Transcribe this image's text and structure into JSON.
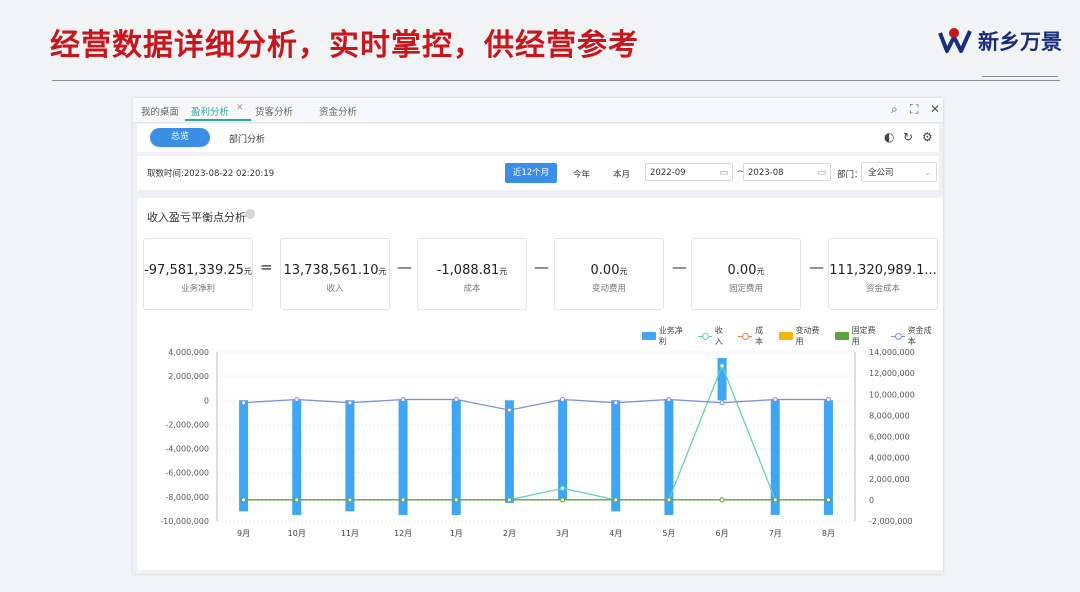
{
  "slide": {
    "title": "经营数据详细分析，实时掌控，供经营参考",
    "brand": "新乡万景"
  },
  "tabs": [
    {
      "label": "我的桌面"
    },
    {
      "label": "盈利分析",
      "active": true
    },
    {
      "label": "货客分析"
    },
    {
      "label": "资金分析"
    }
  ],
  "subnav": {
    "overview": "总览",
    "department": "部门分析"
  },
  "filter": {
    "fetch_time": "取数时间:2023-08-22 02:20:19",
    "btn_recent": "近12个月",
    "btn_year": "今年",
    "btn_month": "本月",
    "date_from": "2022-09",
    "date_to": "2023-08",
    "tilde": "~",
    "dept_label": "部门：",
    "dept_value": "全公司"
  },
  "panel": {
    "title": "收入盈亏平衡点分析"
  },
  "kpis": [
    {
      "value": "-97,581,339.25",
      "unit": "元",
      "label": "业务净利"
    },
    {
      "value": "13,738,561.10",
      "unit": "元",
      "label": "收入"
    },
    {
      "value": "-1,088.81",
      "unit": "元",
      "label": "成本"
    },
    {
      "value": "0.00",
      "unit": "元",
      "label": "变动费用"
    },
    {
      "value": "0.00",
      "unit": "元",
      "label": "固定费用"
    },
    {
      "value": "111,320,989.1...",
      "unit": "",
      "label": "资金成本"
    }
  ],
  "operators": [
    "=",
    "—",
    "—",
    "—",
    "—"
  ],
  "chart_data": {
    "type": "bar",
    "categories": [
      "9月",
      "10月",
      "11月",
      "12月",
      "1月",
      "2月",
      "3月",
      "4月",
      "5月",
      "6月",
      "7月",
      "8月"
    ],
    "series": [
      {
        "name": "业务净利",
        "kind": "bar",
        "axis": "left",
        "color": "#3ea6f2",
        "values": [
          -9200000,
          -9500000,
          -9200000,
          -9500000,
          -9500000,
          -8500000,
          -8300000,
          -9200000,
          -9500000,
          3500000,
          -9500000,
          -9500000
        ]
      },
      {
        "name": "收入",
        "kind": "line",
        "axis": "right",
        "color": "#5fd3b3",
        "values": [
          0,
          0,
          0,
          0,
          0,
          0,
          1100000,
          0,
          0,
          12700000,
          0,
          0
        ]
      },
      {
        "name": "成本",
        "kind": "line",
        "axis": "right",
        "color": "#ee7a4a",
        "values": [
          0,
          0,
          0,
          0,
          0,
          0,
          0,
          0,
          0,
          0,
          0,
          0
        ]
      },
      {
        "name": "变动费用",
        "kind": "line",
        "axis": "right",
        "color": "#f5b50a",
        "values": [
          0,
          0,
          0,
          0,
          0,
          0,
          0,
          0,
          0,
          0,
          0,
          0
        ]
      },
      {
        "name": "固定费用",
        "kind": "line",
        "axis": "right",
        "color": "#5aa33d",
        "values": [
          0,
          0,
          0,
          0,
          0,
          0,
          0,
          0,
          0,
          0,
          0,
          0
        ]
      },
      {
        "name": "资金成本",
        "kind": "line",
        "axis": "right",
        "color": "#7d8fd8",
        "values": [
          9200000,
          9500000,
          9200000,
          9500000,
          9500000,
          8500000,
          9500000,
          9200000,
          9500000,
          9200000,
          9500000,
          9500000
        ]
      }
    ],
    "yleft": {
      "min": -10000000,
      "max": 4000000,
      "ticks": [
        "4,000,000",
        "2,000,000",
        "0",
        "-2,000,000",
        "-4,000,000",
        "-6,000,000",
        "-8,000,000",
        "-10,000,000"
      ]
    },
    "yright": {
      "min": -2000000,
      "max": 14000000,
      "ticks": [
        "14,000,000",
        "12,000,000",
        "10,000,000",
        "8,000,000",
        "6,000,000",
        "4,000,000",
        "2,000,000",
        "0",
        "-2,000,000"
      ]
    },
    "legend_position": "top-right",
    "grid": true
  }
}
